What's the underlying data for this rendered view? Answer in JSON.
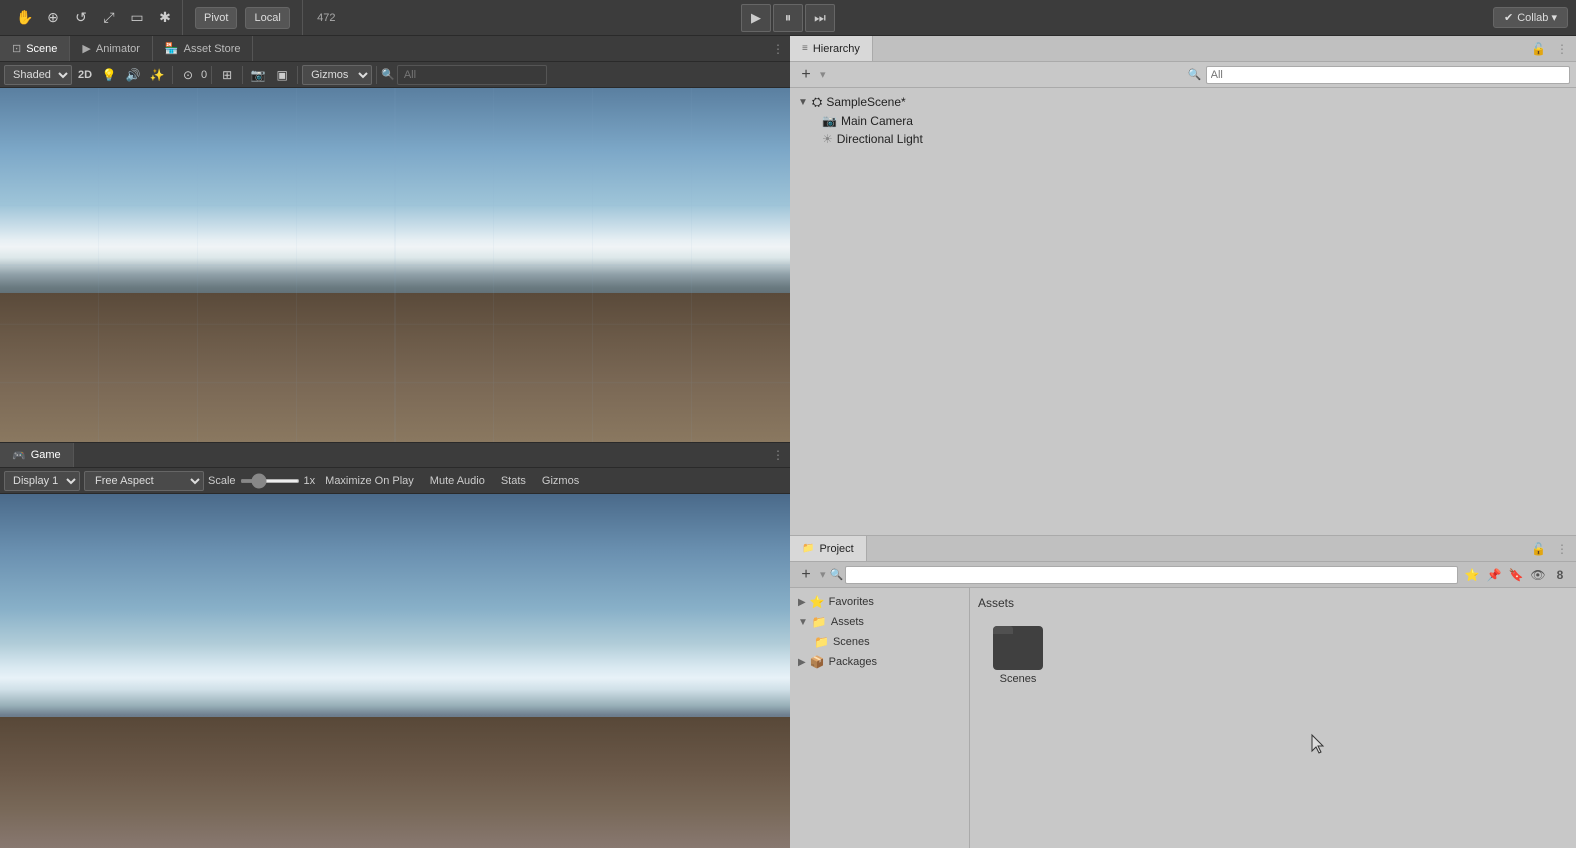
{
  "toolbar": {
    "tools": [
      "hand",
      "move",
      "rotate",
      "scale",
      "rect",
      "custom"
    ],
    "tool_icons": [
      "✋",
      "⊕",
      "↻",
      "⤢",
      "▭",
      "✱"
    ],
    "pivot_label": "Pivot",
    "local_label": "Local",
    "version": "472",
    "collab_label": "Collab ▾",
    "play_btn": "▶",
    "pause_btn": "⏸",
    "step_btn": "⏭"
  },
  "scene_panel": {
    "tabs": [
      "Scene",
      "Animator",
      "Asset Store"
    ],
    "tab_icons": [
      "⊡",
      "▶",
      "🏪"
    ],
    "active_tab": "Scene",
    "shaded_label": "Shaded",
    "twod_label": "2D",
    "gizmos_label": "Gizmos",
    "search_placeholder": "All",
    "light_btn": "💡",
    "audio_btn": "🔊",
    "effects_btn": "✨",
    "overlay_val": "0",
    "menu_icon": "⋮"
  },
  "game_panel": {
    "tab_label": "Game",
    "tab_icon": "🎮",
    "display_label": "Display 1",
    "aspect_label": "Free Aspect",
    "scale_label": "Scale",
    "scale_value": "1x",
    "maximize_label": "Maximize On Play",
    "mute_label": "Mute Audio",
    "stats_label": "Stats",
    "gizmos_label": "Gizmos",
    "menu_icon": "⋮"
  },
  "hierarchy_panel": {
    "tab_label": "Hierarchy",
    "tab_icon": "≡",
    "search_placeholder": "All",
    "items": [
      {
        "name": "SampleScene*",
        "type": "scene",
        "depth": 0,
        "has_arrow": true,
        "arrow_dir": "down"
      },
      {
        "name": "Main Camera",
        "type": "camera",
        "depth": 1
      },
      {
        "name": "Directional Light",
        "type": "light",
        "depth": 1
      }
    ]
  },
  "project_panel": {
    "tab_label": "Project",
    "tab_icon": "📁",
    "search_placeholder": "",
    "tree": {
      "items": [
        {
          "name": "Favorites",
          "depth": 0,
          "icon": "⭐",
          "has_arrow": true,
          "arrow_dir": "right"
        },
        {
          "name": "Assets",
          "depth": 0,
          "icon": "📁",
          "has_arrow": true,
          "arrow_dir": "down",
          "selected": false
        },
        {
          "name": "Scenes",
          "depth": 1,
          "icon": "📁"
        },
        {
          "name": "Packages",
          "depth": 0,
          "icon": "📦",
          "has_arrow": true,
          "arrow_dir": "right"
        }
      ]
    },
    "assets_title": "Assets",
    "assets": [
      {
        "name": "Scenes",
        "type": "folder"
      }
    ]
  }
}
